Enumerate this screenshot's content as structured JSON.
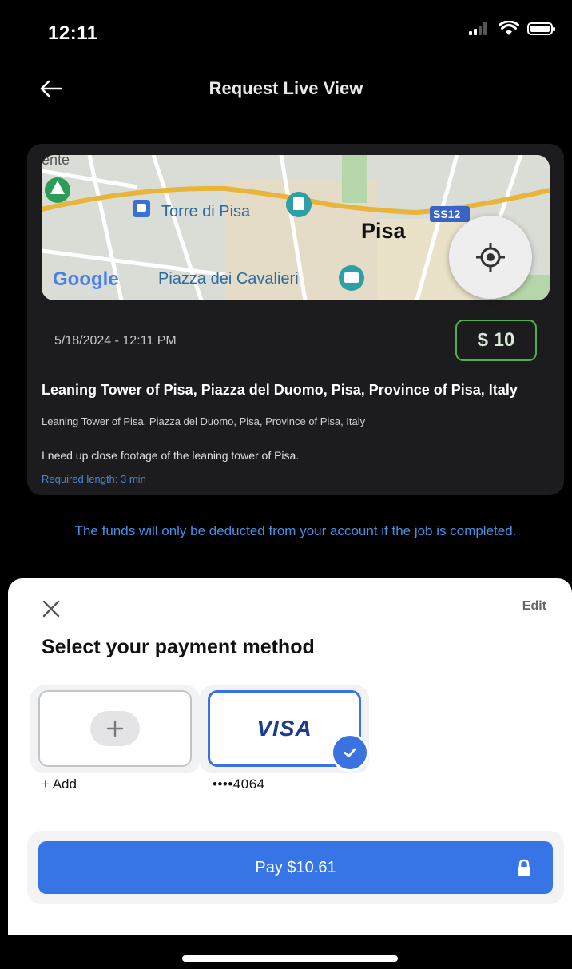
{
  "status_bar": {
    "time": "12:11"
  },
  "header": {
    "title": "Request Live View"
  },
  "job": {
    "map": {
      "labels": {
        "partial_place": "ente",
        "tower": "Torre di Pisa",
        "city": "Pisa",
        "road": "SS12",
        "square": "Piazza dei Cavalieri",
        "provider": "Google"
      }
    },
    "datetime": "5/18/2024 - 12:11 PM",
    "price": "$ 10",
    "location_title": "Leaning Tower of Pisa, Piazza del Duomo, Pisa, Province of Pisa, Italy",
    "location_subtitle": "Leaning Tower of Pisa, Piazza del Duomo, Pisa, Province of Pisa, Italy",
    "description": " I need up close footage of the leaning tower of Pisa.",
    "required_length": "Required length: 3 min"
  },
  "notice": "The funds will only be deducted from your account if the job is completed.",
  "payment_sheet": {
    "edit_label": "Edit",
    "title": "Select your payment method",
    "add_label": "+ Add",
    "card_brand": "VISA",
    "card_label": "••••4064",
    "pay_label": "Pay $10.61"
  },
  "colors": {
    "accent_blue": "#3775e6",
    "price_border_green": "#4caf50",
    "notice_blue": "#4a8fe0"
  },
  "icons": {
    "back": "arrow-left-icon",
    "locate": "crosshair-icon",
    "close": "close-icon",
    "add": "plus-icon",
    "selected": "check-icon",
    "lock": "lock-icon"
  }
}
